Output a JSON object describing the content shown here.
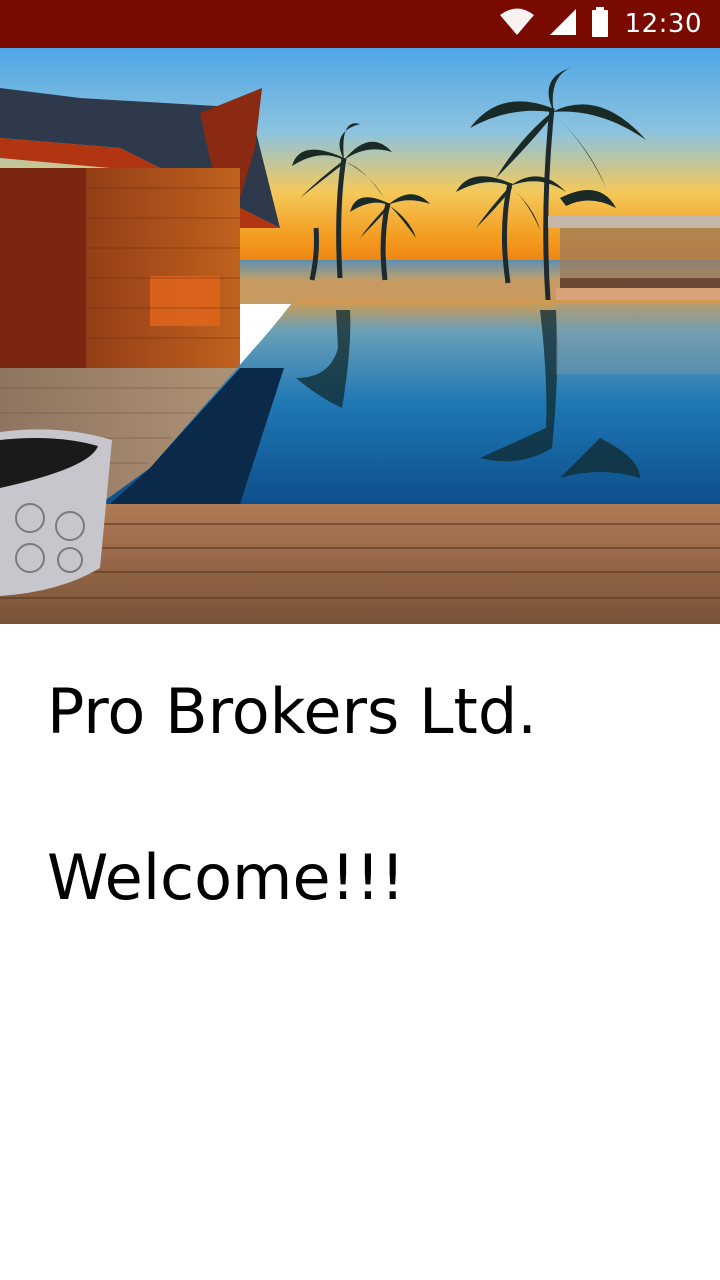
{
  "status_bar": {
    "time": "12:30",
    "icons": [
      "wifi-icon",
      "cellular-signal-icon",
      "battery-icon"
    ],
    "background_color": "#780a00"
  },
  "hero_image": {
    "subject": "resort-pool-sunset-image"
  },
  "main": {
    "title": "Pro Brokers Ltd.",
    "welcome": "Welcome!!!"
  }
}
